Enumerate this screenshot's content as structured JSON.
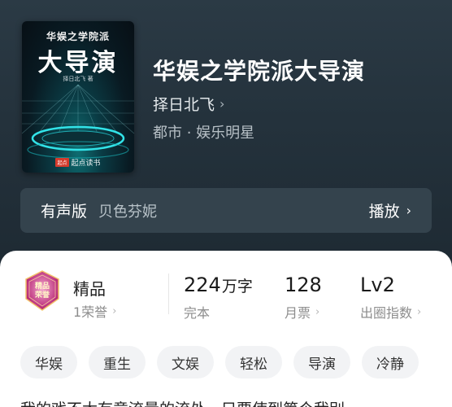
{
  "cover": {
    "subtitle": "华娱之学院派",
    "title": "大导演",
    "author_small": "择日北飞 著",
    "publisher_badge": "起点",
    "publisher": "起点读书"
  },
  "book": {
    "title": "华娱之学院派大导演",
    "author": "择日北飞",
    "genre": "都市 · 娱乐明星"
  },
  "audio": {
    "label": "有声版",
    "narrator": "贝色芬妮",
    "play_label": "播放"
  },
  "stats": {
    "quality": {
      "label": "精品",
      "honor": "1荣誉"
    },
    "words": {
      "value": "224",
      "unit": "万字",
      "label": "完本"
    },
    "tickets": {
      "value": "128",
      "label": "月票"
    },
    "level": {
      "value": "Lv2",
      "label": "出圈指数"
    }
  },
  "medal_text": "精品荣誉",
  "tags": [
    "华娱",
    "重生",
    "文娱",
    "轻松",
    "导演",
    "冷静"
  ],
  "intro_partial": "我的戏不太有意流量的流处，只要使到第个我别"
}
